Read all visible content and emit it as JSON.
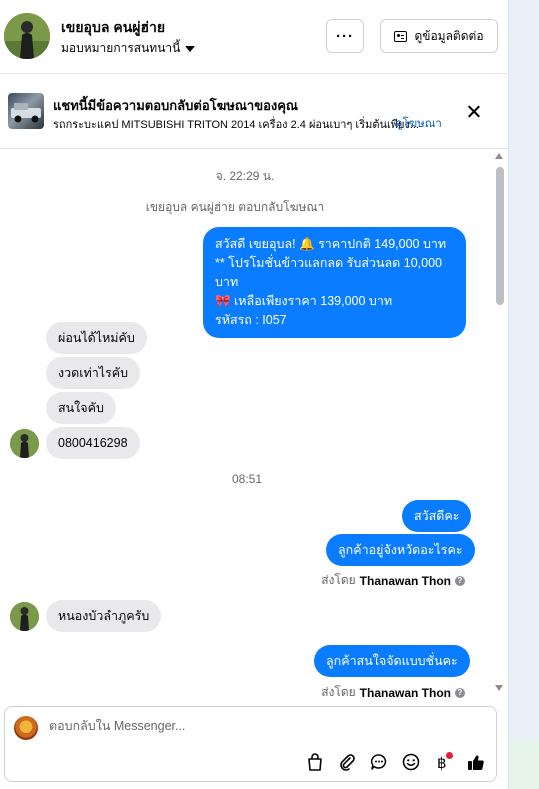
{
  "header": {
    "name": "เขยอุบล คนผู่ฮ่าย",
    "assign": "มอบหมายการสนทนานี้",
    "more": "···",
    "contact_button": "ดูข้อมูลติดต่อ"
  },
  "ad": {
    "title": "แชทนี้มีข้อความตอบกลับต่อโฆษณาของคุณ",
    "desc": "รถกระบะแคป MITSUBISHI TRITON 2014 เครื่อง 2.4 ผ่อนเบาๆ เริ่มต้นเพียง...",
    "link": "ดูโฆษณา"
  },
  "messages": {
    "time1": "จ. 22:29 น.",
    "replied_note": "เขยอุบล คนผู่ฮ่าย ตอบกลับโฆษณา",
    "ad_reply_lines": [
      "สวัสดี เขยอุบล! 🔔 ราคาปกติ 149,000 บาท",
      "** โปรโมชั่นข้าวแลกลด รับส่วนลด 10,000 บาท",
      "🎀 เหลือเพียงราคา 139,000 บาท",
      "รหัสรถ : I057"
    ],
    "in1": "ผ่อนได้ไหม่คับ",
    "in2": "งวดเท่าไรคับ",
    "in3": "สนใจคับ",
    "in4": "0800416298",
    "time2": "08:51",
    "out1": "สวัสดีคะ",
    "out2": "ลูกค้าอยู่จังหวัดอะไรคะ",
    "sent_by_prefix": "ส่งโดย",
    "sent_by_name": "Thanawan Thon",
    "in5": "หนองบัวลำภูครับ",
    "out3": "ลูกค้าสนใจจัดแบบชั่นคะ"
  },
  "composer": {
    "placeholder": "ตอบกลับใน Messenger..."
  },
  "colors": {
    "accent": "#0a7cff",
    "link": "#0a5fc2",
    "incoming_bubble": "#e9e9eb",
    "notification": "#e41e3f"
  }
}
